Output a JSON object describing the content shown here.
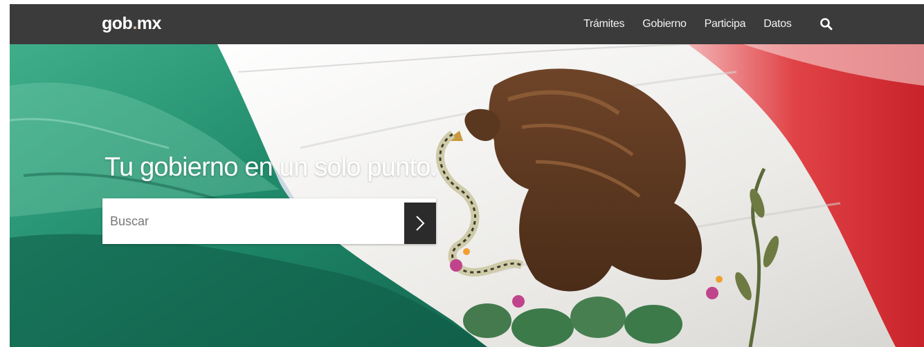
{
  "header": {
    "logo": {
      "text": "gob",
      "dot": ".",
      "suffix": "mx"
    },
    "nav": [
      {
        "label": "Trámites"
      },
      {
        "label": "Gobierno"
      },
      {
        "label": "Participa"
      },
      {
        "label": "Datos"
      }
    ],
    "search_icon": "search-icon"
  },
  "hero": {
    "tagline": "Tu gobierno en un solo punto.",
    "search": {
      "placeholder": "Buscar",
      "value": "",
      "button_icon": "chevron-right-icon"
    },
    "background": "mexican-flag-image"
  },
  "colors": {
    "navbar": "#3b3b3b",
    "flag_green": "#1f8a6a",
    "flag_white": "#f3f1ee",
    "flag_red": "#d22a2e",
    "search_button": "#2b2b2b"
  }
}
